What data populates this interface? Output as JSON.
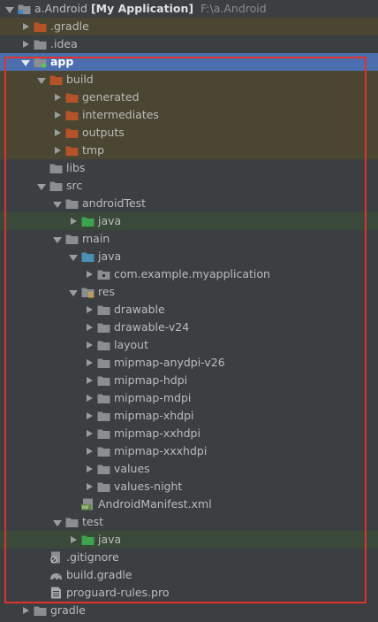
{
  "project": {
    "name": "a.Android",
    "module_title": "[My Application]",
    "path": "F:\\a.Android"
  },
  "items": [
    {
      "label": "a.Android",
      "depth": 0,
      "arrow": "down",
      "icon": "module-folder-icon",
      "kind": "root"
    },
    {
      "label": ".gradle",
      "depth": 1,
      "arrow": "right",
      "icon": "folder-orange-icon",
      "kind": "excluded"
    },
    {
      "label": ".idea",
      "depth": 1,
      "arrow": "right",
      "icon": "folder-icon",
      "kind": "normal"
    },
    {
      "label": "app",
      "depth": 1,
      "arrow": "down",
      "icon": "module-app-folder-icon",
      "kind": "selected"
    },
    {
      "label": "build",
      "depth": 2,
      "arrow": "down",
      "icon": "folder-orange-icon",
      "kind": "excluded"
    },
    {
      "label": "generated",
      "depth": 3,
      "arrow": "right",
      "icon": "folder-orange-icon",
      "kind": "excluded"
    },
    {
      "label": "intermediates",
      "depth": 3,
      "arrow": "right",
      "icon": "folder-orange-icon",
      "kind": "excluded"
    },
    {
      "label": "outputs",
      "depth": 3,
      "arrow": "right",
      "icon": "folder-orange-icon",
      "kind": "excluded"
    },
    {
      "label": "tmp",
      "depth": 3,
      "arrow": "right",
      "icon": "folder-orange-icon",
      "kind": "excluded"
    },
    {
      "label": "libs",
      "depth": 2,
      "arrow": "none",
      "icon": "folder-icon",
      "kind": "normal"
    },
    {
      "label": "src",
      "depth": 2,
      "arrow": "down",
      "icon": "folder-icon",
      "kind": "normal"
    },
    {
      "label": "androidTest",
      "depth": 3,
      "arrow": "down",
      "icon": "folder-icon",
      "kind": "normal"
    },
    {
      "label": "java",
      "depth": 4,
      "arrow": "right",
      "icon": "folder-green-icon",
      "kind": "test"
    },
    {
      "label": "main",
      "depth": 3,
      "arrow": "down",
      "icon": "folder-icon",
      "kind": "normal"
    },
    {
      "label": "java",
      "depth": 4,
      "arrow": "down",
      "icon": "folder-blue-icon",
      "kind": "normal"
    },
    {
      "label": "com.example.myapplication",
      "depth": 5,
      "arrow": "right",
      "icon": "package-icon",
      "kind": "normal"
    },
    {
      "label": "res",
      "depth": 4,
      "arrow": "down",
      "icon": "resource-folder-icon",
      "kind": "normal"
    },
    {
      "label": "drawable",
      "depth": 5,
      "arrow": "right",
      "icon": "folder-icon",
      "kind": "normal"
    },
    {
      "label": "drawable-v24",
      "depth": 5,
      "arrow": "right",
      "icon": "folder-icon",
      "kind": "normal"
    },
    {
      "label": "layout",
      "depth": 5,
      "arrow": "right",
      "icon": "folder-icon",
      "kind": "normal"
    },
    {
      "label": "mipmap-anydpi-v26",
      "depth": 5,
      "arrow": "right",
      "icon": "folder-icon",
      "kind": "normal"
    },
    {
      "label": "mipmap-hdpi",
      "depth": 5,
      "arrow": "right",
      "icon": "folder-icon",
      "kind": "normal"
    },
    {
      "label": "mipmap-mdpi",
      "depth": 5,
      "arrow": "right",
      "icon": "folder-icon",
      "kind": "normal"
    },
    {
      "label": "mipmap-xhdpi",
      "depth": 5,
      "arrow": "right",
      "icon": "folder-icon",
      "kind": "normal"
    },
    {
      "label": "mipmap-xxhdpi",
      "depth": 5,
      "arrow": "right",
      "icon": "folder-icon",
      "kind": "normal"
    },
    {
      "label": "mipmap-xxxhdpi",
      "depth": 5,
      "arrow": "right",
      "icon": "folder-icon",
      "kind": "normal"
    },
    {
      "label": "values",
      "depth": 5,
      "arrow": "right",
      "icon": "folder-icon",
      "kind": "normal"
    },
    {
      "label": "values-night",
      "depth": 5,
      "arrow": "right",
      "icon": "folder-icon",
      "kind": "normal"
    },
    {
      "label": "AndroidManifest.xml",
      "depth": 4,
      "arrow": "none",
      "icon": "manifest-file-icon",
      "kind": "normal"
    },
    {
      "label": "test",
      "depth": 3,
      "arrow": "down",
      "icon": "folder-icon",
      "kind": "normal"
    },
    {
      "label": "java",
      "depth": 4,
      "arrow": "right",
      "icon": "folder-green-icon",
      "kind": "test"
    },
    {
      "label": ".gitignore",
      "depth": 2,
      "arrow": "none",
      "icon": "gitignore-file-icon",
      "kind": "normal"
    },
    {
      "label": "build.gradle",
      "depth": 2,
      "arrow": "none",
      "icon": "gradle-file-icon",
      "kind": "normal"
    },
    {
      "label": "proguard-rules.pro",
      "depth": 2,
      "arrow": "none",
      "icon": "text-file-icon",
      "kind": "normal"
    },
    {
      "label": "gradle",
      "depth": 1,
      "arrow": "right",
      "icon": "folder-icon",
      "kind": "normal"
    }
  ],
  "colors": {
    "folder": "#8a8e91",
    "folder_orange": "#b4532a",
    "folder_green": "#3fa34d",
    "folder_blue": "#4a8fb5",
    "highlight_box": "#e0322d",
    "selection": "#4b6eaf"
  }
}
